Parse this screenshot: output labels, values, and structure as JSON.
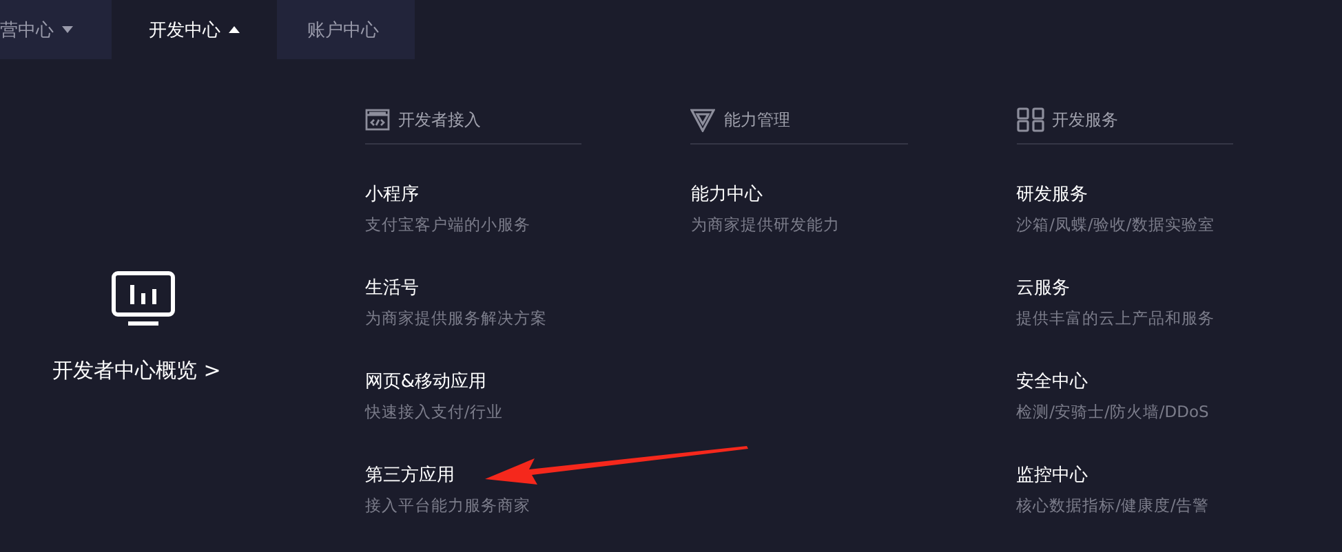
{
  "nav_tabs": [
    {
      "label": "营中心",
      "selected": false,
      "kind": "closed_menu"
    },
    {
      "label": "开发中心",
      "selected": true,
      "kind": "open_menu"
    },
    {
      "label": "账户中心",
      "selected": false,
      "kind": "link"
    }
  ],
  "overview": {
    "label": "开发者中心概览 >"
  },
  "columns": [
    {
      "title": "开发者接入",
      "items": [
        {
          "title": "小程序",
          "description": "支付宝客户端的小服务"
        },
        {
          "title": "生活号",
          "description": "为商家提供服务解决方案"
        },
        {
          "title": "网页&移动应用",
          "description": "快速接入支付/行业"
        },
        {
          "title": "第三方应用",
          "description": "接入平台能力服务商家"
        }
      ]
    },
    {
      "title": "能力管理",
      "items": [
        {
          "title": "能力中心",
          "description": "为商家提供研发能力"
        }
      ]
    },
    {
      "title": "开发服务",
      "items": [
        {
          "title": "研发服务",
          "description": "沙箱/凤蝶/验收/数据实验室"
        },
        {
          "title": "云服务",
          "description": "提供丰富的云上产品和服务"
        },
        {
          "title": "安全中心",
          "description": "检测/安骑士/防火墙/DDoS"
        },
        {
          "title": "监控中心",
          "description": "核心数据指标/健康度/告警"
        }
      ]
    }
  ],
  "annotations": [
    {
      "kind": "arrow"
    }
  ]
}
